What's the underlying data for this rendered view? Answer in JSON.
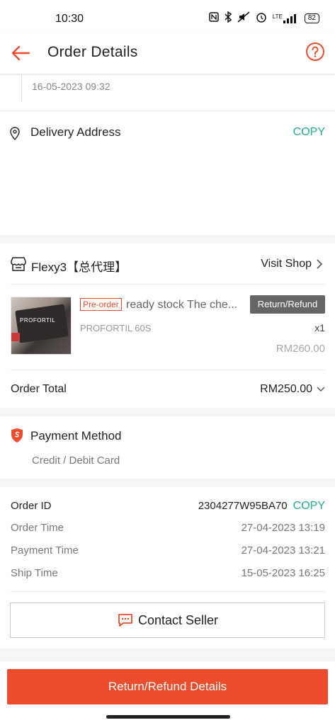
{
  "status_bar": {
    "time": "10:30",
    "network": "LTE",
    "battery": "82"
  },
  "header": {
    "title": "Order Details"
  },
  "timeline": {
    "date": "16-05-2023 09:32"
  },
  "delivery": {
    "label": "Delivery Address",
    "copy_label": "COPY"
  },
  "shop": {
    "name": "Flexy3【总代理】",
    "visit_label": "Visit Shop"
  },
  "product": {
    "tag": "Pre-order",
    "title": "ready stock The che...",
    "return_badge": "Return/Refund",
    "variant": "PROFORTIL 60S",
    "quantity": "x1",
    "price": "RM260.00",
    "thumb_text": "PROFORTIL"
  },
  "order_total": {
    "label": "Order Total",
    "value": "RM250.00"
  },
  "payment": {
    "label": "Payment Method",
    "value": "Credit / Debit Card"
  },
  "order_info": {
    "order_id_label": "Order ID",
    "order_id": "2304277W95BA70",
    "copy_label": "COPY",
    "order_time_label": "Order Time",
    "order_time": "27-04-2023 13:19",
    "payment_time_label": "Payment Time",
    "payment_time": "27-04-2023 13:21",
    "ship_time_label": "Ship Time",
    "ship_time": "15-05-2023 16:25"
  },
  "actions": {
    "contact_seller": "Contact Seller",
    "return_refund_details": "Return/Refund Details"
  },
  "colors": {
    "brand": "#ee4d2d",
    "copy": "#26aa99"
  }
}
